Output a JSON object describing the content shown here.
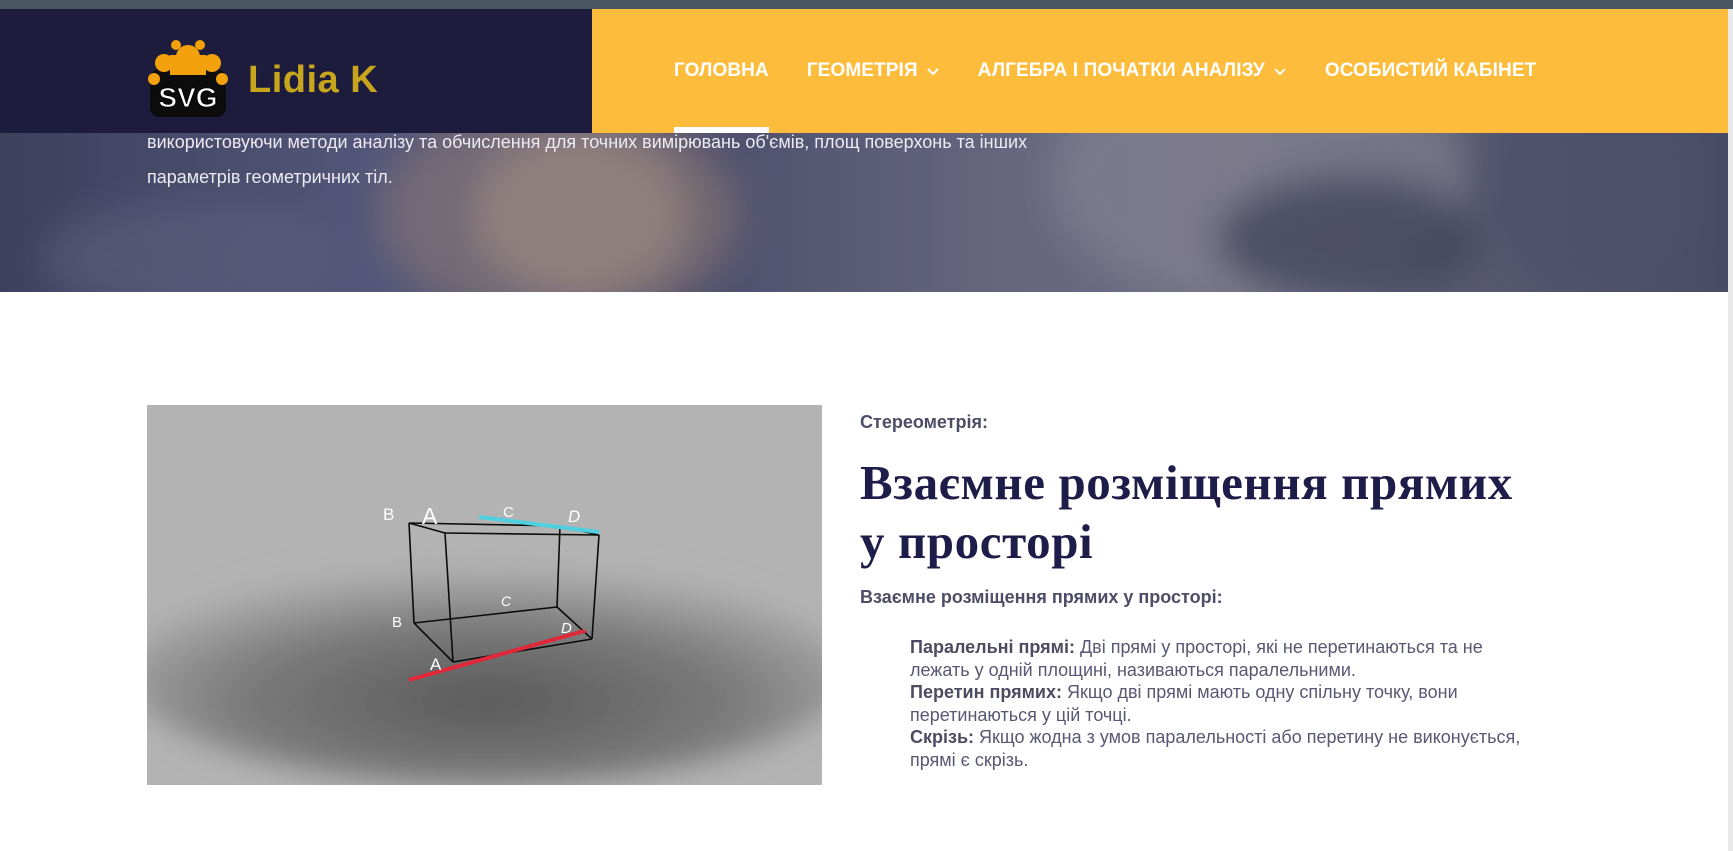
{
  "brand": {
    "logo_text": "Lidia K",
    "badge_text": "SVG"
  },
  "nav": {
    "items": [
      {
        "label": "ГОЛОВНА",
        "active": true,
        "dropdown": false
      },
      {
        "label": "ГЕОМЕТРІЯ",
        "active": false,
        "dropdown": true
      },
      {
        "label": "АЛГЕБРА І ПОЧАТКИ АНАЛІЗУ",
        "active": false,
        "dropdown": true
      },
      {
        "label": "ОСОБИСТИЙ КАБІНЕТ",
        "active": false,
        "dropdown": false
      }
    ]
  },
  "hero": {
    "line1": "використовуючи методи аналізу та обчислення для точних вимірювань об'ємів, площ поверхонь та інших",
    "line2": "параметрів геометричних тіл."
  },
  "figure": {
    "labels": {
      "B1": "B",
      "A1": "A",
      "C1": "C",
      "D1": "D",
      "B": "B",
      "C": "C",
      "D": "D",
      "A": "A"
    },
    "colors": {
      "top_line": "#4fd0e0",
      "bottom_line": "#e0283a"
    }
  },
  "article": {
    "kicker": "Стереометрія:",
    "title": "Взаємне розміщення прямих у просторі",
    "subhead": "Взаємне розміщення прямих у просторі:",
    "items": [
      {
        "term": "Паралельні прямі:",
        "text": " Дві прямі у просторі, які не перетинаються та не лежать у одній площині, називаються паралельними."
      },
      {
        "term": "Перетин прямих:",
        "text": " Якщо дві прямі мають одну спільну точку, вони перетинаються у цій точці."
      },
      {
        "term": "Скрізь:",
        "text": " Якщо жодна з умов паралельності або перетину не виконується, прямі є скрізь."
      }
    ]
  },
  "colors": {
    "header_dark": "#1d1c3d",
    "header_accent": "#fdbc3b",
    "title": "#1e1d4a"
  }
}
